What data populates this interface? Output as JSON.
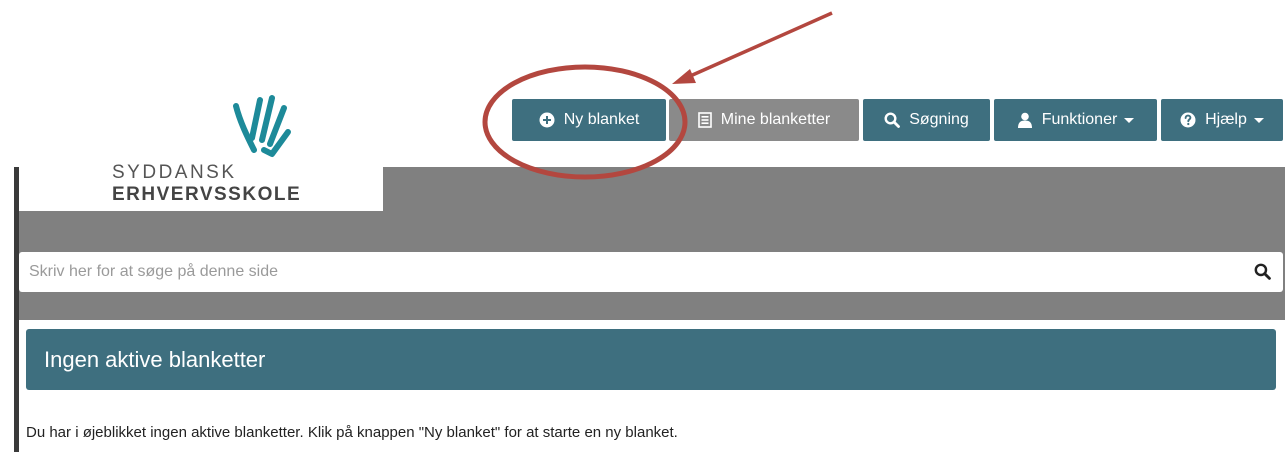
{
  "brand": {
    "line1": "SYDDANSK",
    "line2": "ERHVERVSSKOLE"
  },
  "nav": {
    "new_form": "Ny blanket",
    "my_forms": "Mine blanketter",
    "search": "Søgning",
    "functions": "Funktioner",
    "help": "Hjælp"
  },
  "search": {
    "placeholder": "Skriv her for at søge på denne side"
  },
  "panel": {
    "title": "Ingen aktive blanketter",
    "message": "Du har i øjeblikket ingen aktive blanketter. Klik på knappen \"Ny blanket\" for at starte en ny blanket."
  },
  "icons": {
    "new_form": "plus-circle-icon",
    "my_forms": "list-icon",
    "search": "search-icon",
    "functions": "user-icon",
    "help": "question-circle-icon"
  },
  "colors": {
    "primary": "#3e6f7f",
    "band": "#808080",
    "annotation": "#b3473f",
    "logo": "#1d8a99"
  }
}
